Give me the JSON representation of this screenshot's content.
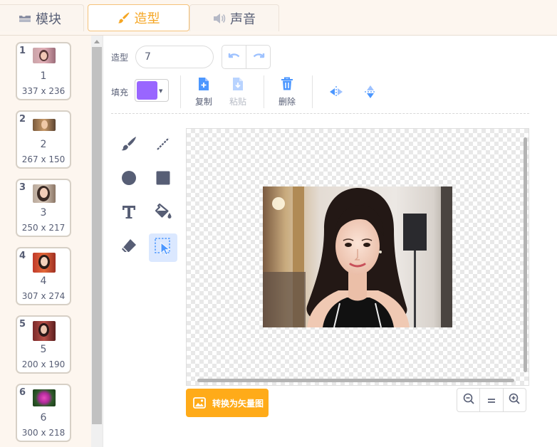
{
  "tabs": {
    "blocks": "模块",
    "costumes": "造型",
    "sounds": "声音"
  },
  "costumes": [
    {
      "num": "1",
      "name": "1",
      "size": "337 x 236"
    },
    {
      "num": "2",
      "name": "2",
      "size": "267 x 150"
    },
    {
      "num": "3",
      "name": "3",
      "size": "250 x 217"
    },
    {
      "num": "4",
      "name": "4",
      "size": "307 x 274"
    },
    {
      "num": "5",
      "name": "5",
      "size": "200 x 190"
    },
    {
      "num": "6",
      "name": "6",
      "size": "300 x 218"
    }
  ],
  "editor": {
    "costume_label": "造型",
    "costume_name": "7",
    "fill_label": "填充",
    "fill_color": "#9966ff",
    "copy_label": "复制",
    "paste_label": "粘贴",
    "delete_label": "删除",
    "convert_label": "转换为矢量图"
  },
  "colors": {
    "accent": "#f5a623",
    "tool_blue": "#4c97ff",
    "icon_gray": "#575e75",
    "convert_button": "#ffab19"
  },
  "tools": [
    "brush-icon",
    "line-icon",
    "circle-icon",
    "rectangle-icon",
    "text-icon",
    "fill-icon",
    "eraser-icon",
    "select-icon"
  ]
}
